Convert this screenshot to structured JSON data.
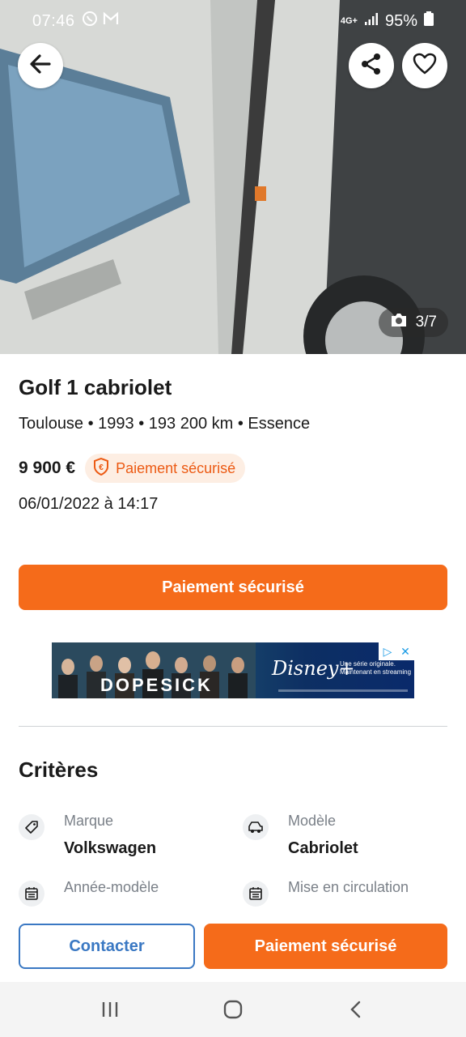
{
  "status_bar": {
    "time": "07:46",
    "network": "4G+",
    "battery": "95%"
  },
  "photo": {
    "counter": "3/7"
  },
  "listing": {
    "title": "Golf 1 cabriolet",
    "subtitle": "Toulouse • 1993 • 193 200 km • Essence",
    "price": "9 900 €",
    "secure_badge": "Paiement sécurisé",
    "date": "06/01/2022 à 14:17"
  },
  "primary_action": {
    "label": "Paiement sécurisé"
  },
  "ad": {
    "title": "DOPESICK",
    "brand": "Disney+",
    "tagline": "Une série originale. Maintenant en streaming"
  },
  "criteria": {
    "heading": "Critères",
    "items": [
      {
        "label": "Marque",
        "value": "Volkswagen",
        "icon": "tag-icon"
      },
      {
        "label": "Modèle",
        "value": "Cabriolet",
        "icon": "car-icon"
      },
      {
        "label": "Année-modèle",
        "value": "",
        "icon": "calendar-icon"
      },
      {
        "label": "Mise en circulation",
        "value": "",
        "icon": "calendar-icon"
      }
    ]
  },
  "bottom_bar": {
    "contact_label": "Contacter",
    "pay_label": "Paiement sécurisé"
  },
  "colors": {
    "accent": "#f56b1a",
    "link": "#3a78c3",
    "badge_bg": "#fdeee3"
  }
}
